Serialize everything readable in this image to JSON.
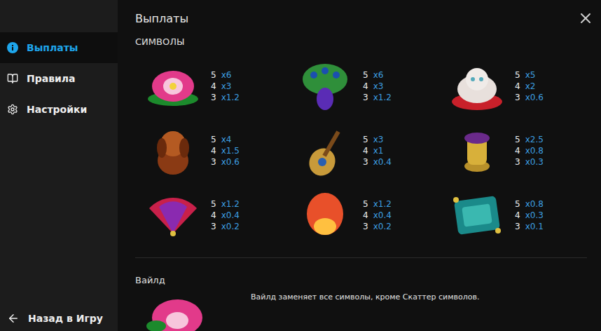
{
  "sidebar": {
    "items": [
      {
        "label": "Выплаты",
        "selected": true
      },
      {
        "label": "Правила",
        "selected": false
      },
      {
        "label": "Настройки",
        "selected": false
      }
    ],
    "back": "Назад в Игру"
  },
  "header": {
    "title": "Выплаты"
  },
  "section": {
    "title": "СИМВОЛЫ"
  },
  "symbols": [
    {
      "pays": [
        {
          "count": "5",
          "mult": "x6"
        },
        {
          "count": "4",
          "mult": "x3"
        },
        {
          "count": "3",
          "mult": "x1.2"
        }
      ]
    },
    {
      "pays": [
        {
          "count": "5",
          "mult": "x6"
        },
        {
          "count": "4",
          "mult": "x3"
        },
        {
          "count": "3",
          "mult": "x1.2"
        }
      ]
    },
    {
      "pays": [
        {
          "count": "5",
          "mult": "x5"
        },
        {
          "count": "4",
          "mult": "x2"
        },
        {
          "count": "3",
          "mult": "x0.6"
        }
      ]
    },
    {
      "pays": [
        {
          "count": "5",
          "mult": "x4"
        },
        {
          "count": "4",
          "mult": "x1.5"
        },
        {
          "count": "3",
          "mult": "x0.6"
        }
      ]
    },
    {
      "pays": [
        {
          "count": "5",
          "mult": "x3"
        },
        {
          "count": "4",
          "mult": "x1"
        },
        {
          "count": "3",
          "mult": "x0.4"
        }
      ]
    },
    {
      "pays": [
        {
          "count": "5",
          "mult": "x2.5"
        },
        {
          "count": "4",
          "mult": "x0.8"
        },
        {
          "count": "3",
          "mult": "x0.3"
        }
      ]
    },
    {
      "pays": [
        {
          "count": "5",
          "mult": "x1.2"
        },
        {
          "count": "4",
          "mult": "x0.4"
        },
        {
          "count": "3",
          "mult": "x0.2"
        }
      ]
    },
    {
      "pays": [
        {
          "count": "5",
          "mult": "x1.2"
        },
        {
          "count": "4",
          "mult": "x0.4"
        },
        {
          "count": "3",
          "mult": "x0.2"
        }
      ]
    },
    {
      "pays": [
        {
          "count": "5",
          "mult": "x0.8"
        },
        {
          "count": "4",
          "mult": "x0.3"
        },
        {
          "count": "3",
          "mult": "x0.1"
        }
      ]
    }
  ],
  "wild": {
    "title": "Вайлд",
    "description": "Вайлд заменяет все символы, кроме Скаттер символов."
  }
}
